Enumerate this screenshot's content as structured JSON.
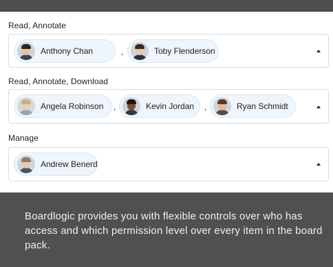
{
  "groups": [
    {
      "label": "Read, Annotate",
      "members": [
        "Anthony Chan",
        "Toby Flenderson"
      ],
      "separator": ","
    },
    {
      "label": "Read, Annotate, Download",
      "members": [
        "Angela Robinson",
        "Kevin Jordan",
        "Ryan Schmidt"
      ],
      "separator": ","
    },
    {
      "label": "Manage",
      "members": [
        "Andrew Benerd"
      ]
    }
  ],
  "footer": {
    "text": "Boardlogic provides you with flexible controls over who has access and which permission level over every item in the board pack."
  },
  "colors": {
    "top_bar": "#4e4e4e",
    "footer_bg": "#505050",
    "chip_bg": "#eef5fb",
    "chip_border": "#d9e8f5"
  },
  "icons": {
    "expand": "caret-up-icon"
  }
}
